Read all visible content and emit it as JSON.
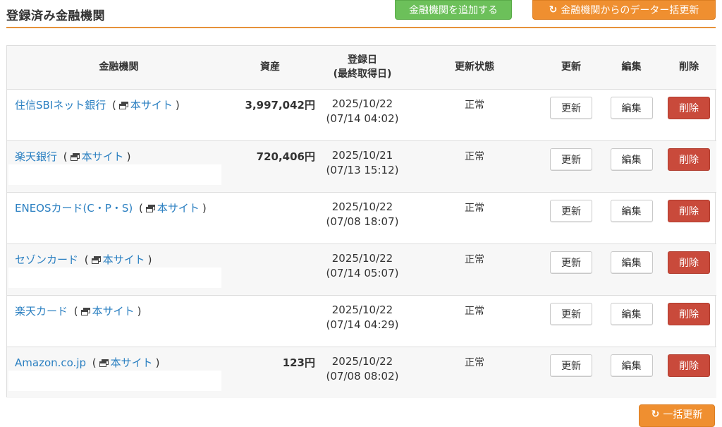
{
  "header": {
    "title": "登録済み金融機関",
    "add_button": "金融機関を追加する",
    "bulk_update_all_button": "金融機関からのデーター括更新"
  },
  "table": {
    "columns": {
      "institution": "金融機関",
      "assets": "資産",
      "date_line1": "登録日",
      "date_line2": "(最終取得日)",
      "status": "更新状態",
      "update": "更新",
      "edit": "編集",
      "delete": "削除"
    },
    "site_link_label": "本サイト",
    "paren_open": "(",
    "paren_close": ")",
    "rows": [
      {
        "name": "住信SBIネット銀行",
        "assets": "3,997,042円",
        "registered": "2025/10/22",
        "last_fetched": "(07/14 04:02)",
        "status": "正常",
        "update": "更新",
        "edit": "編集",
        "delete": "削除"
      },
      {
        "name": "楽天銀行",
        "assets": "720,406円",
        "registered": "2025/10/21",
        "last_fetched": "(07/13 15:12)",
        "status": "正常",
        "update": "更新",
        "edit": "編集",
        "delete": "削除"
      },
      {
        "name": "ENEOSカード(C・P・S)",
        "assets": "",
        "registered": "2025/10/22",
        "last_fetched": "(07/08 18:07)",
        "status": "正常",
        "update": "更新",
        "edit": "編集",
        "delete": "削除"
      },
      {
        "name": "セゾンカード",
        "assets": "",
        "registered": "2025/10/22",
        "last_fetched": "(07/14 05:07)",
        "status": "正常",
        "update": "更新",
        "edit": "編集",
        "delete": "削除"
      },
      {
        "name": "楽天カード",
        "assets": "",
        "registered": "2025/10/22",
        "last_fetched": "(07/14 04:29)",
        "status": "正常",
        "update": "更新",
        "edit": "編集",
        "delete": "削除"
      },
      {
        "name": "Amazon.co.jp",
        "assets": "123円",
        "registered": "2025/10/22",
        "last_fetched": "(07/08 08:02)",
        "status": "正常",
        "update": "更新",
        "edit": "編集",
        "delete": "削除"
      }
    ]
  },
  "footer": {
    "bulk_update_button": "一括更新"
  },
  "icons": {
    "refresh": "refresh-icon",
    "external_window": "external-window-icon"
  },
  "colors": {
    "accent_orange": "#ef8f30",
    "add_green": "#6cc05a",
    "delete_red": "#c94a3b",
    "link_blue": "#2a7fc1"
  }
}
